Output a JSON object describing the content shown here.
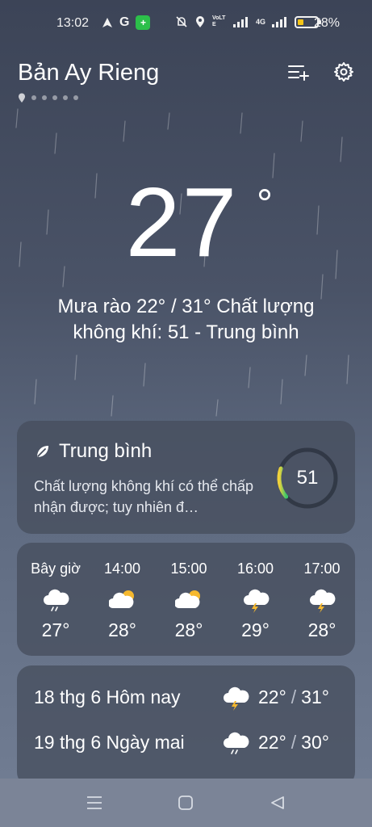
{
  "status_bar": {
    "time": "13:02",
    "battery_percent": "28%",
    "battery_level": 0.28,
    "network_label": "4G",
    "volte_label": "VoLTE",
    "google_label": "G",
    "shield_label": "+"
  },
  "header": {
    "location": "Bản Ay Rieng",
    "page_count": 6,
    "active_page": 0
  },
  "current": {
    "temperature": "27",
    "degree_symbol": "°",
    "summary": "Mưa rào  22° / 31°  Chất lượng không khí: 51 - Trung bình"
  },
  "air_quality": {
    "title": "Trung bình",
    "description": "Chất lượng không khí có thể chấp nhận được; tuy nhiên đ…",
    "index": "51",
    "index_fraction": 0.17,
    "accent": "#3cc76a",
    "accent_end": "#f2d23c"
  },
  "hourly": [
    {
      "time": "Bây giờ",
      "icon": "rain-cloud-icon",
      "temp": "27°"
    },
    {
      "time": "14:00",
      "icon": "partly-cloudy-icon",
      "temp": "28°"
    },
    {
      "time": "15:00",
      "icon": "partly-cloudy-icon",
      "temp": "28°"
    },
    {
      "time": "16:00",
      "icon": "thunder-cloud-icon",
      "temp": "29°"
    },
    {
      "time": "17:00",
      "icon": "thunder-cloud-icon",
      "temp": "28°"
    }
  ],
  "daily": [
    {
      "label": "18 thg 6 Hôm nay",
      "icon": "thunder-cloud-icon",
      "low": "22°",
      "separator": "/",
      "high": "31°"
    },
    {
      "label": "19 thg 6 Ngày mai",
      "icon": "rain-cloud-icon",
      "low": "22°",
      "separator": "/",
      "high": "30°"
    }
  ],
  "colors": {
    "sun": "#f5b82e",
    "bolt": "#f5b82e",
    "cloud": "#ffffff"
  }
}
